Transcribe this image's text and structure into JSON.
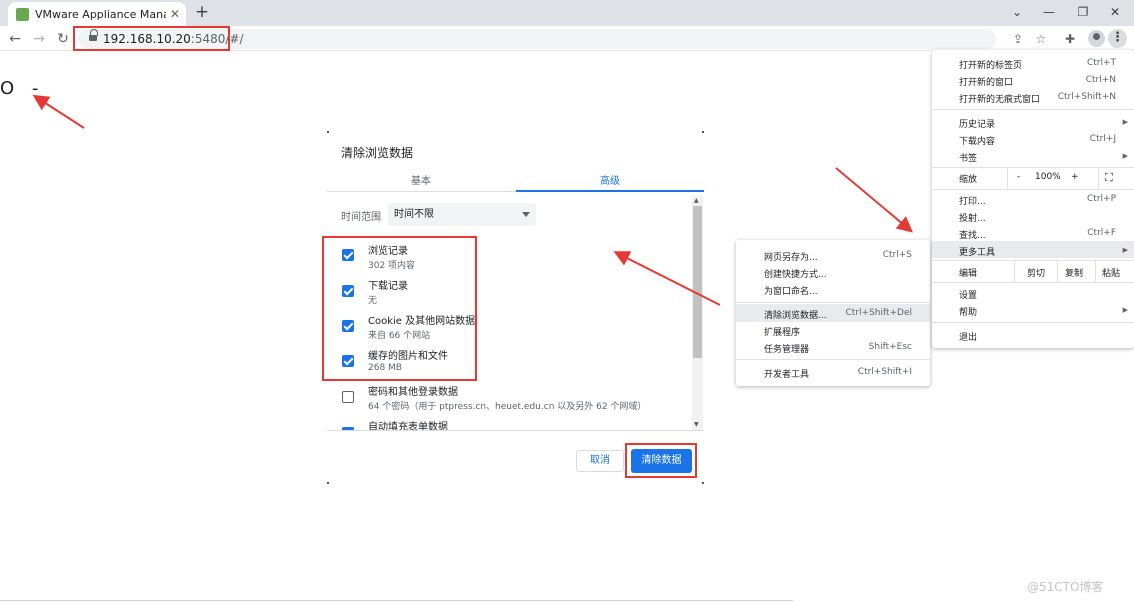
{
  "browser": {
    "tab_title": "VMware Appliance Manageme",
    "url_host": "192.168.10.20",
    "url_path": ":5480/#/"
  },
  "page": {
    "content_text": "O -"
  },
  "dialog": {
    "title": "清除浏览数据",
    "tabs": [
      "基本",
      "高级"
    ],
    "time_range_label": "时间范围",
    "time_range_value": "时间不限",
    "items": [
      {
        "label": "浏览记录",
        "sub": "302 项内容",
        "checked": true
      },
      {
        "label": "下载记录",
        "sub": "无",
        "checked": true
      },
      {
        "label": "Cookie 及其他网站数据",
        "sub": "来自 66 个网站",
        "checked": true
      },
      {
        "label": "缓存的图片和文件",
        "sub": "268 MB",
        "checked": true
      },
      {
        "label": "密码和其他登录数据",
        "sub": "64 个密码（用于 ptpress.cn、heuet.edu.cn 以及另外 62 个网域）",
        "checked": false
      },
      {
        "label": "自动填充表单数据",
        "sub": "",
        "checked": true
      }
    ],
    "cancel_label": "取消",
    "clear_label": "清除数据"
  },
  "main_menu": {
    "new_tab": "打开新的标签页",
    "new_tab_sc": "Ctrl+T",
    "new_window": "打开新的窗口",
    "new_window_sc": "Ctrl+N",
    "incognito": "打开新的无痕式窗口",
    "incognito_sc": "Ctrl+Shift+N",
    "history": "历史记录",
    "downloads": "下载内容",
    "downloads_sc": "Ctrl+J",
    "bookmarks": "书签",
    "zoom": "缩放",
    "zoom_minus": "-",
    "zoom_value": "100%",
    "zoom_plus": "+",
    "print": "打印...",
    "print_sc": "Ctrl+P",
    "cast": "投射...",
    "find": "查找...",
    "find_sc": "Ctrl+F",
    "more_tools": "更多工具",
    "edit": "编辑",
    "cut": "剪切",
    "copy": "复制",
    "paste": "粘贴",
    "settings": "设置",
    "help": "帮助",
    "exit": "退出"
  },
  "more_tools_menu": {
    "save_page": "网页另存为...",
    "save_page_sc": "Ctrl+S",
    "create_shortcut": "创建快捷方式...",
    "name_window": "为窗口命名...",
    "clear_data": "清除浏览数据...",
    "clear_data_sc": "Ctrl+Shift+Del",
    "extensions": "扩展程序",
    "task_manager": "任务管理器",
    "task_manager_sc": "Shift+Esc",
    "dev_tools": "开发者工具",
    "dev_tools_sc": "Ctrl+Shift+I"
  },
  "watermark": "@51CTO博客",
  "colors": {
    "accent": "#1a73e8",
    "annotation_red": "#e53935"
  }
}
